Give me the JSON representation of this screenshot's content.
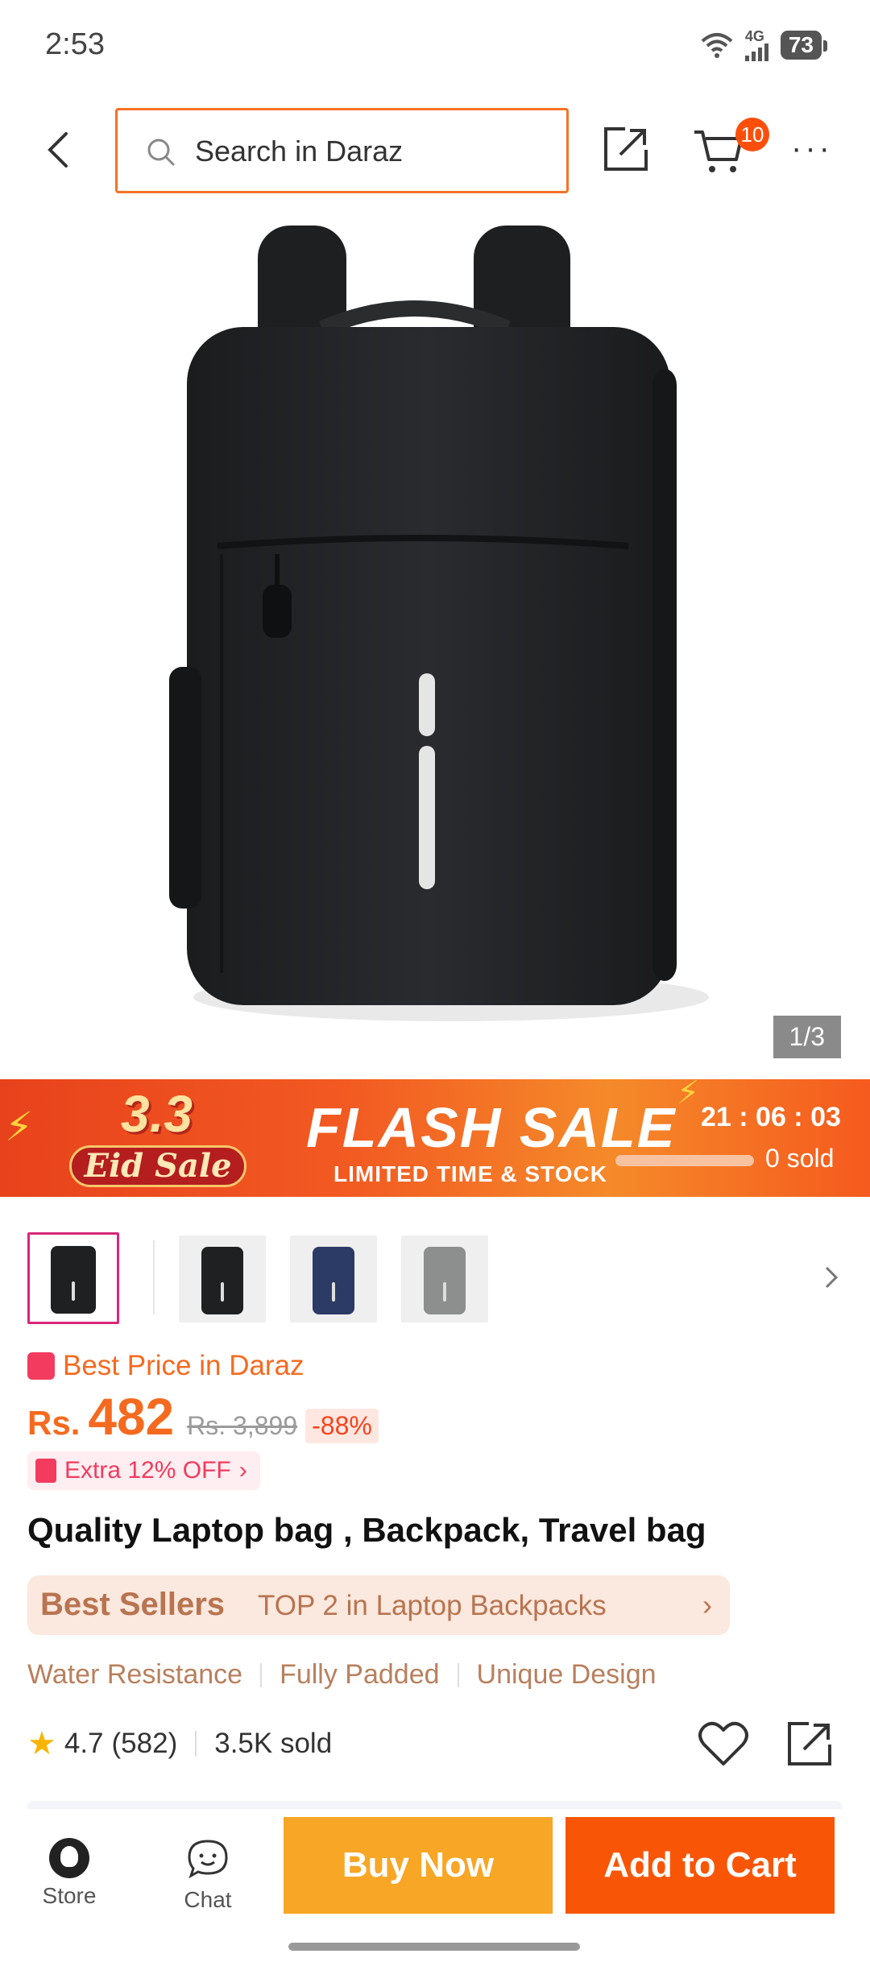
{
  "status_bar": {
    "time": "2:53",
    "network": "4G",
    "battery": "73"
  },
  "header": {
    "search_placeholder": "Search in Daraz",
    "cart_count": "10"
  },
  "gallery": {
    "counter": "1/3"
  },
  "flash_sale": {
    "eid_number": "3.3",
    "eid_text": "Eid Sale",
    "title": "FLASH SALE",
    "subtitle": "LIMITED TIME & STOCK",
    "timer": "21 : 06 : 03",
    "sold": "0 sold",
    "sold_progress": 0
  },
  "price": {
    "best_price_label": "Best Price in Daraz",
    "currency": "Rs.",
    "current": "482",
    "original": "Rs. 3,899",
    "discount": "-88%",
    "extra_offer": "Extra 12% OFF"
  },
  "product": {
    "title": "Quality Laptop bag , Backpack, Travel bag",
    "best_sellers_label": "Best Sellers",
    "best_sellers_rank": "TOP 2 in Laptop Backpacks",
    "features": [
      "Water Resistance",
      "Fully Padded",
      "Unique Design"
    ],
    "rating": "4.7",
    "reviews": "(582)",
    "sold": "3.5K sold"
  },
  "thumbnails": [
    {
      "color": "#1f2022"
    },
    {
      "color": "#1f2022"
    },
    {
      "color": "#2c3a66"
    },
    {
      "color": "#8c8f8e"
    }
  ],
  "bottom_bar": {
    "store_label": "Store",
    "chat_label": "Chat",
    "buy_now": "Buy Now",
    "add_to_cart": "Add to Cart"
  },
  "colors": {
    "accent": "#f57224",
    "buy_now": "#f8a625",
    "add_to_cart": "#f85606"
  }
}
